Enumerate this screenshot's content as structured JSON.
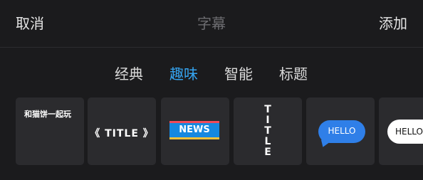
{
  "header": {
    "cancel_label": "取消",
    "title": "字幕",
    "add_label": "添加"
  },
  "tabs": [
    {
      "label": "经典",
      "active": false
    },
    {
      "label": "趣味",
      "active": true
    },
    {
      "label": "智能",
      "active": false
    },
    {
      "label": "标题",
      "active": false
    }
  ],
  "cards": [
    {
      "text": "和猫饼一起玩"
    },
    {
      "text": "《 TITLE 》"
    },
    {
      "text": "NEWS"
    },
    {
      "text": "TITLE"
    },
    {
      "text": "HELLO"
    },
    {
      "text": "HELLO"
    }
  ],
  "colors": {
    "background": "#1b1b1d",
    "card_background": "#2b2b2e",
    "active_tab": "#35a4f0",
    "news_blue": "#1588e0",
    "bubble_blue": "#2f7fe8"
  }
}
